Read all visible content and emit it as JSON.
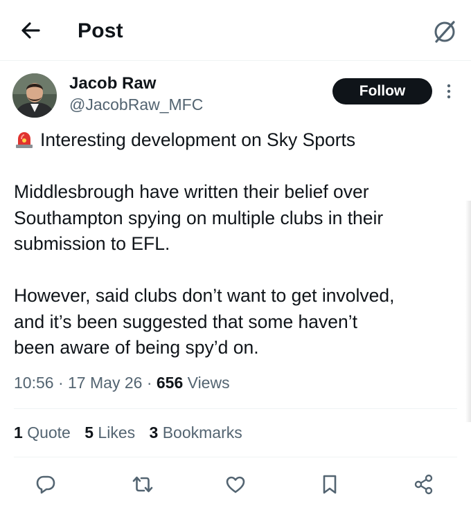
{
  "header": {
    "title": "Post",
    "back_icon": "arrow-left-icon",
    "grok_icon": "grok-slash-icon"
  },
  "author": {
    "display_name": "Jacob Raw",
    "handle": "@JacobRaw_MFC",
    "follow_label": "Follow",
    "more_icon": "more-vertical-icon"
  },
  "post": {
    "lines": [
      "Interesting development on Sky Sports",
      "Middlesbrough have written their belief over",
      "Southampton spying on multiple clubs in their",
      "submission to EFL.",
      "However, said clubs don’t want to get involved,",
      "and it’s been suggested that some haven’t",
      "been aware of being spy’d on."
    ],
    "emoji": "rotating-light-icon"
  },
  "meta": {
    "time": "10:56",
    "date": "17 May 26",
    "separator": "·",
    "views_count": "656",
    "views_label": "Views"
  },
  "stats": {
    "quotes_count": "1",
    "quotes_label": "Quote",
    "likes_count": "5",
    "likes_label": "Likes",
    "bookmarks_count": "3",
    "bookmarks_label": "Bookmarks"
  },
  "actions": [
    "reply-icon",
    "repost-icon",
    "like-icon",
    "bookmark-icon",
    "share-icon"
  ],
  "colors": {
    "text": "#0f1419",
    "secondary": "#536471",
    "divider": "#eff3f4",
    "follow_bg": "#0f1419",
    "siren_red": "#e0332f"
  }
}
